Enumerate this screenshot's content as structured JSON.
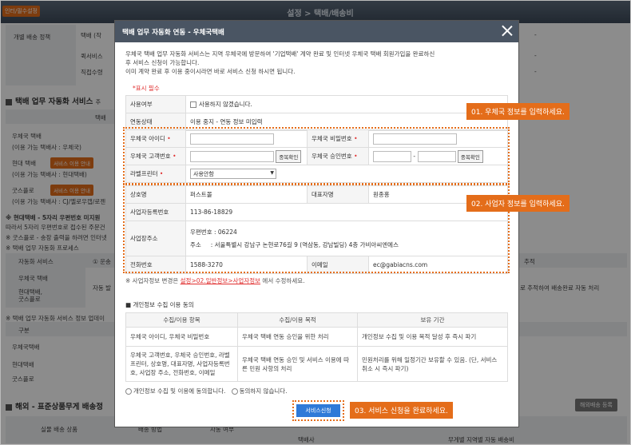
{
  "background": {
    "required_badge": "인터/필수설정",
    "header_title": "설정 > 택배/배송비",
    "rows": {
      "individual_policy": "개별 배송 정책",
      "courier_label": "택배 (작",
      "quick_label": "퀵서비스",
      "pickup_label": "직접수령",
      "dash1": "-",
      "dash2": "-",
      "dash3": "-"
    },
    "section_auto": "택배 업무 자동화 서비스",
    "section_auto_suffix": "주",
    "service_label": "택배",
    "epost_title": "우체국 택배",
    "epost_sub": "(이용 가능 택배사 : 우체국)",
    "hyundai_title": "현대 택배",
    "hyundai_sub": "(이용 가능 택배사 : 현대택배)",
    "hyundai_btn": "서비스 이용 안내",
    "goodsflow_title": "굿스플로",
    "goodsflow_btn": "서비스 이용 안내",
    "goodsflow_sub": "(이용 가능 택배사 : CJ/옐로우캡/로젠",
    "notice1": "※ 현대택배 - 5자리 우편번호 미지원",
    "notice2": "따라서 5자리 우편번호로 접수된 주문건",
    "notice3": "※ 굿스플로 - 송장 출력을 하려면 인터넷",
    "notice4": "※ 택배 업무 자동화 프로세스",
    "process_label": "자동화 서비스",
    "process_step": "① 운송",
    "process_epost": "우체국 택배",
    "process_auto": "자동 발",
    "process_hyundai": "현대택배,\n굿스플로",
    "process_right_top": "추적",
    "process_right": "로 추적하여 배송완료 자동 처리",
    "notice5": "※ 택배 업무 자동화 서비스 정보 업데이",
    "table_head": "구분",
    "tbl_epost": "우체국택배",
    "tbl_hyundai": "현대택배",
    "tbl_goods": "굿스플로",
    "section_overseas": "해외 - 표준상품무게 배송정",
    "overseas_btn": "해외배송 등록",
    "overseas_col1": "실물 배송 상품",
    "overseas_col2": "배송 방법",
    "overseas_col3": "자동 여부",
    "overseas_col4": "택배사",
    "overseas_col5": "무게별 지역별 자동 배송비"
  },
  "modal": {
    "title": "택배 업무 자동화 연동 - 우체국택배",
    "intro_line1": "우체국 택배 업무 자동화 서비스는 지역 우체국에 방문하여 '기업택배' 계약 완료 및 인터넷 우체국 택배 회원가입을 완료하신",
    "intro_line2": "후 서비스 신청이 가능합니다.",
    "intro_line3": "이미 계약 완료 후 이용 중이시라면 바로 서비스 신청 하시면 됩니다.",
    "required_note": "*표시 필수",
    "usage_label": "사용여부",
    "usage_checkbox": "사용하지 않겠습니다.",
    "link_status_label": "연동상태",
    "link_status_value": "이용 중지 - 연동 정보 미입력",
    "epost_id_label": "우체국 아이디",
    "epost_pw_label": "우체국 비밀번호",
    "epost_customer_label": "우체국 고객번호",
    "epost_approval_label": "우체국 승인번호",
    "dup_check": "중복확인",
    "dup_check2": "중복확인",
    "approval_dash": "-",
    "label_printer_label": "라벨프린터",
    "label_printer_value": "사용안함",
    "company_label": "상호명",
    "company_value": "퍼스트몰",
    "ceo_label": "대표자명",
    "ceo_value": "원종홍",
    "bizno_label": "사업자등록번호",
    "bizno_value": "113-86-18829",
    "address_label": "사업장주소",
    "zip_label": "우편번호 :",
    "zip_value": "06224",
    "addr_label": "주소",
    "addr_colon": ":",
    "addr_value": "서울특별시 강남구 논현로76길 9 (역삼동, 강남빌딩) 4층 가비아씨엔에스",
    "phone_label": "전화번호",
    "phone_value": "1588-3270",
    "email_label": "이메일",
    "email_value": "ec@gabiacns.com",
    "biz_note_prefix": "※ 사업자정보 변경은 ",
    "biz_note_link": "설정>02.일반정보>사업자정보",
    "biz_note_suffix": " 에서 수정하세요.",
    "privacy_title": "■ 개인정보 수집 이용 동의",
    "privacy_headers": [
      "수집/이용 항목",
      "수집/이용 목적",
      "보유 기간"
    ],
    "privacy_rows": [
      [
        "우체국 아이디, 우체국 비밀번호",
        "우체국 택배 연동 승인을 위한 처리",
        "개인정보 수집 및 이용 목적 달성 후 즉시 파기"
      ],
      [
        "우체국 고객번호, 우체국 승인번호, 라벨프린터, 상호명, 대표자명, 사업자등록번호, 사업장 주소, 전화번호, 이메일",
        "우체국 택배 연동 승인 및 서비스 이용에 따른 민원 사항의 처리",
        "민원처리를 위해 일정기간 보유할 수 있음. (단, 서비스 취소 시 즉시 파기)"
      ]
    ],
    "agree_label": "개인정보 수집 및 이용에 동의합니다.",
    "disagree_label": "동의하지 않습니다.",
    "submit_label": "서비스신청"
  },
  "callouts": {
    "step1": "01. 우체국 정보를 입력하세요.",
    "step2": "02. 사업자 정보를 입력하세요.",
    "step3": "03. 서비스 신청을 완료하세요."
  },
  "colors": {
    "accent": "#e46d1a",
    "modal_header": "#4a5563",
    "submit": "#2f7ad8",
    "required": "#e03030"
  }
}
